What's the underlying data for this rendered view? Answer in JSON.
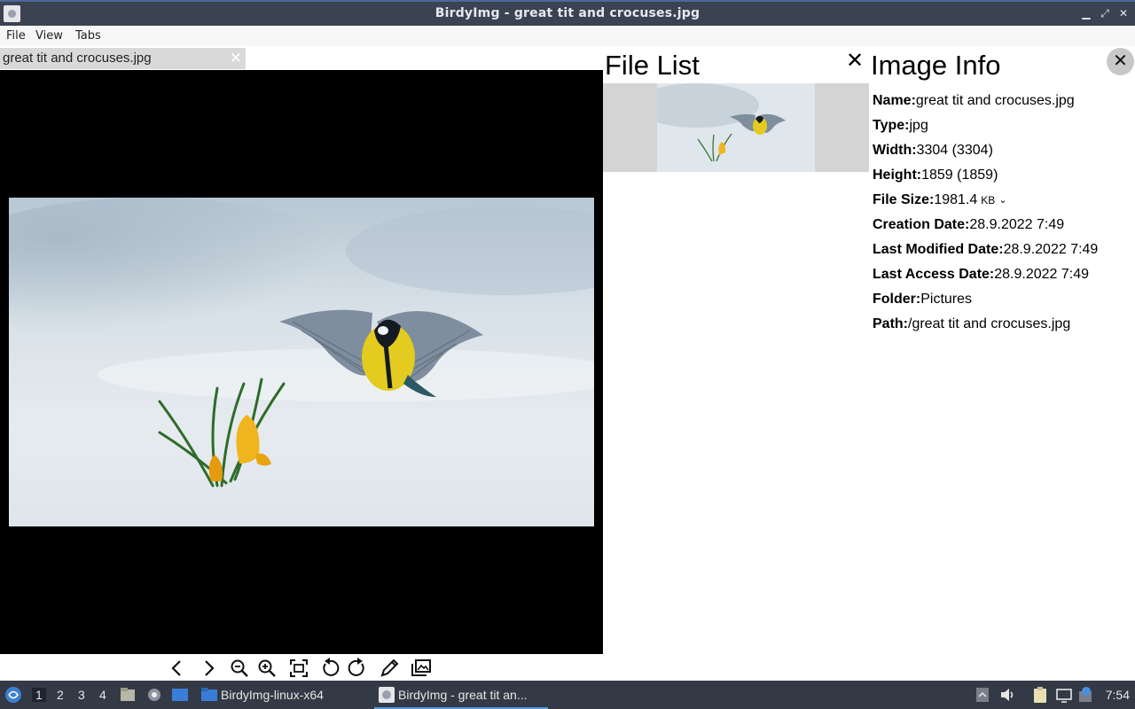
{
  "window": {
    "title": "BirdyImg - great tit and crocuses.jpg",
    "minimize_glyph": "▁",
    "maximize_glyph": "⤢",
    "close_glyph": "✕"
  },
  "menu": {
    "file": "File",
    "view": "View",
    "tabs": "Tabs"
  },
  "tab": {
    "label": "great tit and crocuses.jpg",
    "close_glyph": "✕"
  },
  "file_list": {
    "title": "File List",
    "close_glyph": "✕"
  },
  "image_info": {
    "title": "Image Info",
    "close_glyph": "✕",
    "rows": {
      "name": {
        "key": "Name:",
        "value": "great tit and crocuses.jpg"
      },
      "type": {
        "key": "Type:",
        "value": "jpg"
      },
      "width": {
        "key": "Width:",
        "value": "3304 (3304)"
      },
      "height": {
        "key": "Height:",
        "value": "1859 (1859)"
      },
      "file_size": {
        "key": "File Size:",
        "value": "1981.4",
        "unit": "KB"
      },
      "creation_date": {
        "key": "Creation Date:",
        "value": "28.9.2022 7:49"
      },
      "modified_date": {
        "key": "Last Modified Date:",
        "value": "28.9.2022 7:49"
      },
      "access_date": {
        "key": "Last Access Date:",
        "value": "28.9.2022 7:49"
      },
      "folder": {
        "key": "Folder:",
        "value": "Pictures"
      },
      "path": {
        "key": "Path:",
        "value": "/great tit and crocuses.jpg"
      }
    }
  },
  "toolbar": {
    "icons": [
      "chevron-left-icon",
      "chevron-right-icon",
      "zoom-out-icon",
      "zoom-in-icon",
      "fit-screen-icon",
      "rotate-left-icon",
      "rotate-right-icon",
      "pencil-icon",
      "gallery-icon"
    ]
  },
  "taskbar": {
    "workspaces": [
      "1",
      "2",
      "3",
      "4"
    ],
    "tasks": [
      {
        "label": "BirdyImg-linux-x64"
      },
      {
        "label": "BirdyImg - great tit an..."
      }
    ],
    "clock": "7:54",
    "colors": {
      "bar": "#333a45",
      "active_underline": "#5a9ae0"
    }
  }
}
